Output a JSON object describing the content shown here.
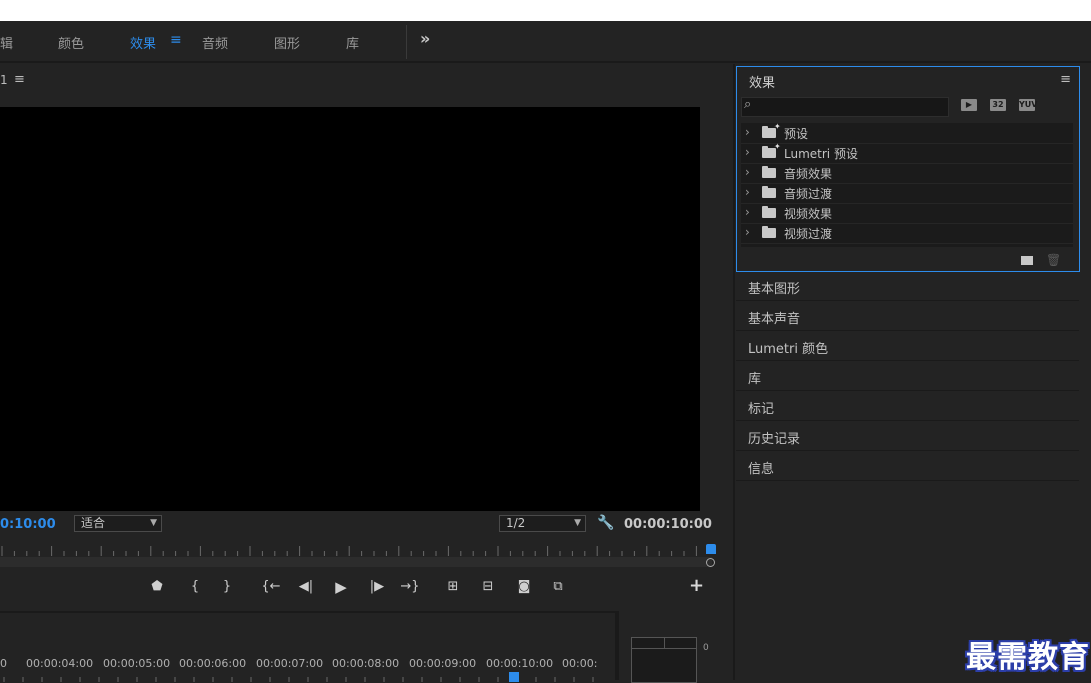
{
  "workspace": {
    "tabs": [
      "辑",
      "颜色",
      "效果",
      "音频",
      "图形",
      "库"
    ],
    "active_tab": "效果",
    "more_icon": "chevron-double-right-icon",
    "accent_color": "#2d8ceb"
  },
  "program_monitor": {
    "title": "1",
    "timecode_current": "0:10:00",
    "fit_select": "适合",
    "resolution_select": "1/2",
    "timecode_duration": "00:00:10:00",
    "transport_icons": [
      "marker-icon",
      "mark-in-icon",
      "mark-out-icon",
      "go-to-in-icon",
      "step-back-icon",
      "play-icon",
      "step-forward-icon",
      "go-to-out-icon",
      "lift-icon",
      "extract-icon",
      "export-frame-icon",
      "comparison-view-icon",
      "add-button-icon"
    ]
  },
  "effects_panel": {
    "title": "效果",
    "search_placeholder": "",
    "badges": [
      "32",
      "YUV"
    ],
    "items": [
      {
        "label": "预设",
        "icon": "preset-folder-icon"
      },
      {
        "label": "Lumetri 预设",
        "icon": "preset-folder-icon"
      },
      {
        "label": "音频效果",
        "icon": "folder-icon"
      },
      {
        "label": "音频过渡",
        "icon": "folder-icon"
      },
      {
        "label": "视频效果",
        "icon": "folder-icon"
      },
      {
        "label": "视频过渡",
        "icon": "folder-icon"
      }
    ]
  },
  "collapsed_panels": [
    "基本图形",
    "基本声音",
    "Lumetri 颜色",
    "库",
    "标记",
    "历史记录",
    "信息"
  ],
  "timeline": {
    "times": [
      "0",
      "00:00:04:00",
      "00:00:05:00",
      "00:00:06:00",
      "00:00:07:00",
      "00:00:08:00",
      "00:00:09:00",
      "00:00:10:00",
      "00:00:"
    ]
  },
  "audio_meter": {
    "zero_label": "0"
  },
  "watermark": "最需教育"
}
